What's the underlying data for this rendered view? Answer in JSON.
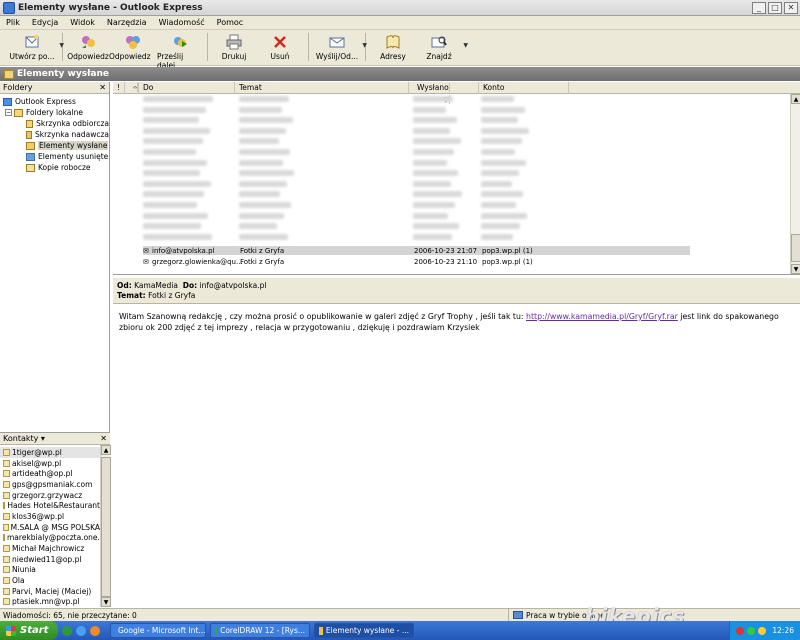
{
  "window": {
    "title": "Elementy wysłane - Outlook Express",
    "controls": [
      "minimize-icon",
      "maximize-icon",
      "close-icon"
    ]
  },
  "menu": [
    "Plik",
    "Edycja",
    "Widok",
    "Narzędzia",
    "Wiadomość",
    "Pomoc"
  ],
  "toolbar": {
    "buttons": [
      {
        "label": "Utwórz po...",
        "icon": "new-mail-icon"
      },
      {
        "label": "Odpowiedz",
        "icon": "reply-icon"
      },
      {
        "label": "Odpowiedz ...",
        "icon": "reply-all-icon"
      },
      {
        "label": "Prześlij dalej",
        "icon": "forward-icon"
      },
      {
        "label": "Drukuj",
        "icon": "print-icon"
      },
      {
        "label": "Usuń",
        "icon": "delete-icon"
      },
      {
        "label": "Wyślij/Od...",
        "icon": "send-receive-icon"
      },
      {
        "label": "Adresy",
        "icon": "address-book-icon"
      },
      {
        "label": "Znajdź",
        "icon": "find-icon"
      }
    ]
  },
  "header_band": {
    "title": "Elementy wysłane"
  },
  "folders_pane": {
    "title": "Foldery",
    "items": [
      {
        "label": "Outlook Express",
        "level": 0
      },
      {
        "label": "Foldery lokalne",
        "level": 1
      },
      {
        "label": "Skrzynka odbiorcza",
        "level": 2
      },
      {
        "label": "Skrzynka nadawcza",
        "level": 2
      },
      {
        "label": "Elementy wysłane",
        "level": 2
      },
      {
        "label": "Elementy usunięte",
        "level": 2
      },
      {
        "label": "Kopie robocze",
        "level": 2
      }
    ]
  },
  "contacts_pane": {
    "title": "Kontakty",
    "items": [
      "1tiger@wp.pl",
      "akisel@wp.pl",
      "artideath@op.pl",
      "gps@gpsmaniak.com",
      "grzegorz.grzywacz",
      "Hades Hotel&Restaurant",
      "klos36@wp.pl",
      "M.SALA @ MSG POLSKA",
      "marekbialy@poczta.one...",
      "Michał Majchrowicz",
      "niedwied11@op.pl",
      "Niunia",
      "Ola",
      "Parvi, Maciej (Maciej)",
      "ptasiek.mn@vp.pl"
    ]
  },
  "message_list": {
    "columns": [
      "!",
      "Do",
      "Temat",
      "Wysłano",
      "Konto"
    ],
    "visible_rows": [
      {
        "to": "info@atvpolska.pl",
        "subject": "Fotki z Gryfa",
        "sent": "2006-10-23 21:07",
        "account": "pop3.wp.pl (1)",
        "selected": true
      },
      {
        "to": "grzegorz.glowienka@qu...",
        "subject": "Fotki z Gryfa",
        "sent": "2006-10-23 21:10",
        "account": "pop3.wp.pl (1)",
        "selected": false
      }
    ]
  },
  "preview": {
    "from_label": "Od:",
    "from": "KamaMedia",
    "to_label": "Do:",
    "to": "info@atvpolska.pl",
    "subject_label": "Temat:",
    "subject": "Fotki z Gryfa",
    "body_before": "Witam Szanowną redakcję , czy można prosić o opublikowanie w galeri zdjęć z Gryf Trophy , jeśli tak tu:",
    "link": "http://www.kamamedia.pl/Gryf/Gryf.rar",
    "body_after": "jest link do spakowanego zbioru ok 200 zdjęć z tej imprezy , relacja w przygotowaniu , dziękuję i pozdrawiam Krzysiek"
  },
  "status": {
    "left": "Wiadomości: 65, nie przeczytane: 0",
    "right": "Praca w trybie online"
  },
  "taskbar": {
    "start": "Start",
    "tasks": [
      {
        "label": "Google - Microsoft Int...",
        "active": false
      },
      {
        "label": "CorelDRAW 12 - [Rys...",
        "active": false
      },
      {
        "label": "Elementy wysłane - ...",
        "active": true
      }
    ],
    "clock": "12:26"
  },
  "watermark": "bikepics"
}
